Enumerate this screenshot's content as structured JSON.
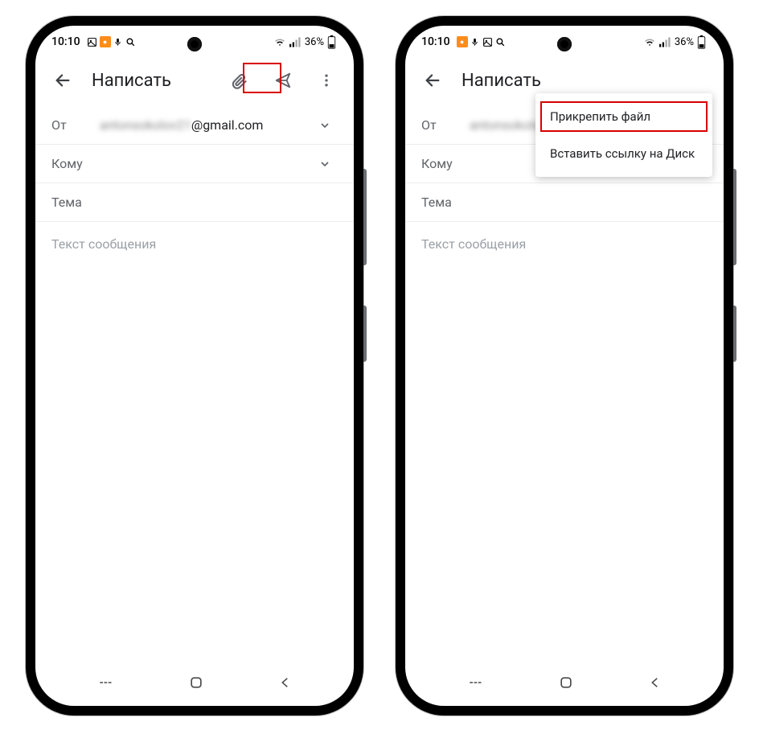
{
  "status": {
    "time": "10:10",
    "battery_text": "36%"
  },
  "compose": {
    "title": "Написать",
    "from_label": "От",
    "from_value_blurred": "antonsokolov21",
    "from_value_tail": "@gmail.com",
    "to_label": "Кому",
    "subject_placeholder": "Тема",
    "body_placeholder": "Текст сообщения"
  },
  "popup": {
    "item_attach": "Прикрепить файл",
    "item_drive": "Вставить ссылку на Диск"
  }
}
